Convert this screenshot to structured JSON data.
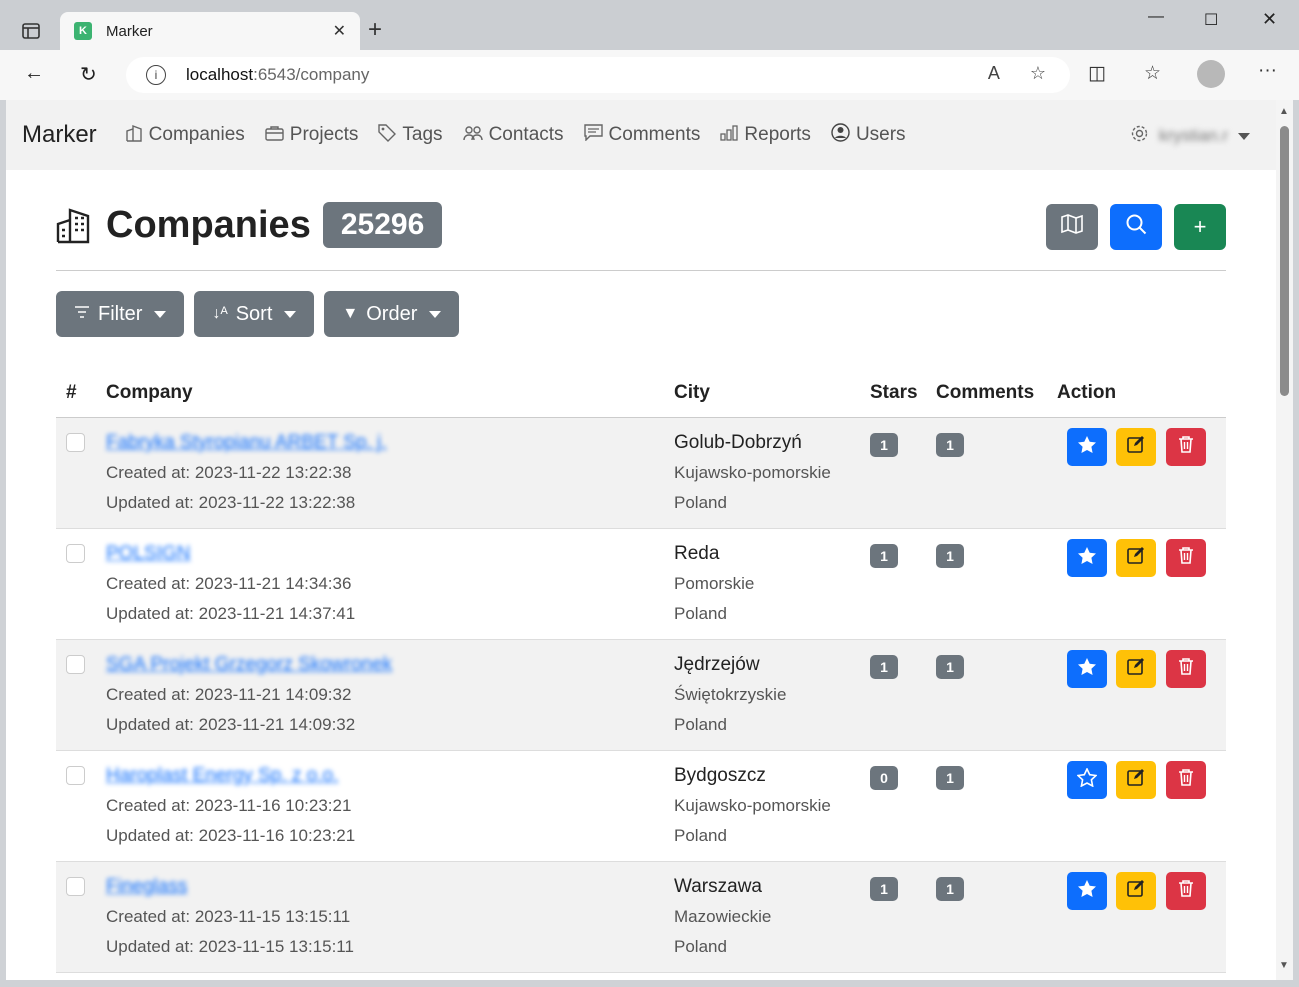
{
  "browser": {
    "tab_title": "Marker",
    "url_host": "localhost",
    "url_path": ":6543/company"
  },
  "navbar": {
    "brand": "Marker",
    "links": [
      {
        "label": "Companies",
        "icon": "building-icon"
      },
      {
        "label": "Projects",
        "icon": "briefcase-icon"
      },
      {
        "label": "Tags",
        "icon": "tag-icon"
      },
      {
        "label": "Contacts",
        "icon": "people-icon"
      },
      {
        "label": "Comments",
        "icon": "comment-icon"
      },
      {
        "label": "Reports",
        "icon": "bar-chart-icon"
      },
      {
        "label": "Users",
        "icon": "person-circle-icon"
      }
    ],
    "user": "krystian.r"
  },
  "page": {
    "title": "Companies",
    "count": "25296",
    "buttons": {
      "filter": "Filter",
      "sort": "Sort",
      "order": "Order"
    }
  },
  "table": {
    "headers": {
      "num": "#",
      "company": "Company",
      "city": "City",
      "stars": "Stars",
      "comments": "Comments",
      "action": "Action"
    },
    "rows": [
      {
        "company": "Fabryka Styropianu ARBET Sp. j.",
        "created": "Created at: 2023-11-22 13:22:38",
        "updated": "Updated at: 2023-11-22 13:22:38",
        "city": "Golub-Dobrzyń",
        "region": "Kujawsko-pomorskie",
        "country": "Poland",
        "stars": "1",
        "comments": "1",
        "starred": true
      },
      {
        "company": "POLSIGN",
        "created": "Created at: 2023-11-21 14:34:36",
        "updated": "Updated at: 2023-11-21 14:37:41",
        "city": "Reda",
        "region": "Pomorskie",
        "country": "Poland",
        "stars": "1",
        "comments": "1",
        "starred": true
      },
      {
        "company": "SGA Projekt Grzegorz Skowronek",
        "created": "Created at: 2023-11-21 14:09:32",
        "updated": "Updated at: 2023-11-21 14:09:32",
        "city": "Jędrzejów",
        "region": "Świętokrzyskie",
        "country": "Poland",
        "stars": "1",
        "comments": "1",
        "starred": true
      },
      {
        "company": "Haroplast Energy Sp. z o.o.",
        "created": "Created at: 2023-11-16 10:23:21",
        "updated": "Updated at: 2023-11-16 10:23:21",
        "city": "Bydgoszcz",
        "region": "Kujawsko-pomorskie",
        "country": "Poland",
        "stars": "0",
        "comments": "1",
        "starred": false
      },
      {
        "company": "Fineglass",
        "created": "Created at: 2023-11-15 13:15:11",
        "updated": "Updated at: 2023-11-15 13:15:11",
        "city": "Warszawa",
        "region": "Mazowieckie",
        "country": "Poland",
        "stars": "1",
        "comments": "1",
        "starred": true
      }
    ]
  },
  "colors": {
    "primary": "#0d6efd",
    "secondary": "#6c757d",
    "success": "#198754",
    "warning": "#ffc107",
    "danger": "#dc3545"
  }
}
